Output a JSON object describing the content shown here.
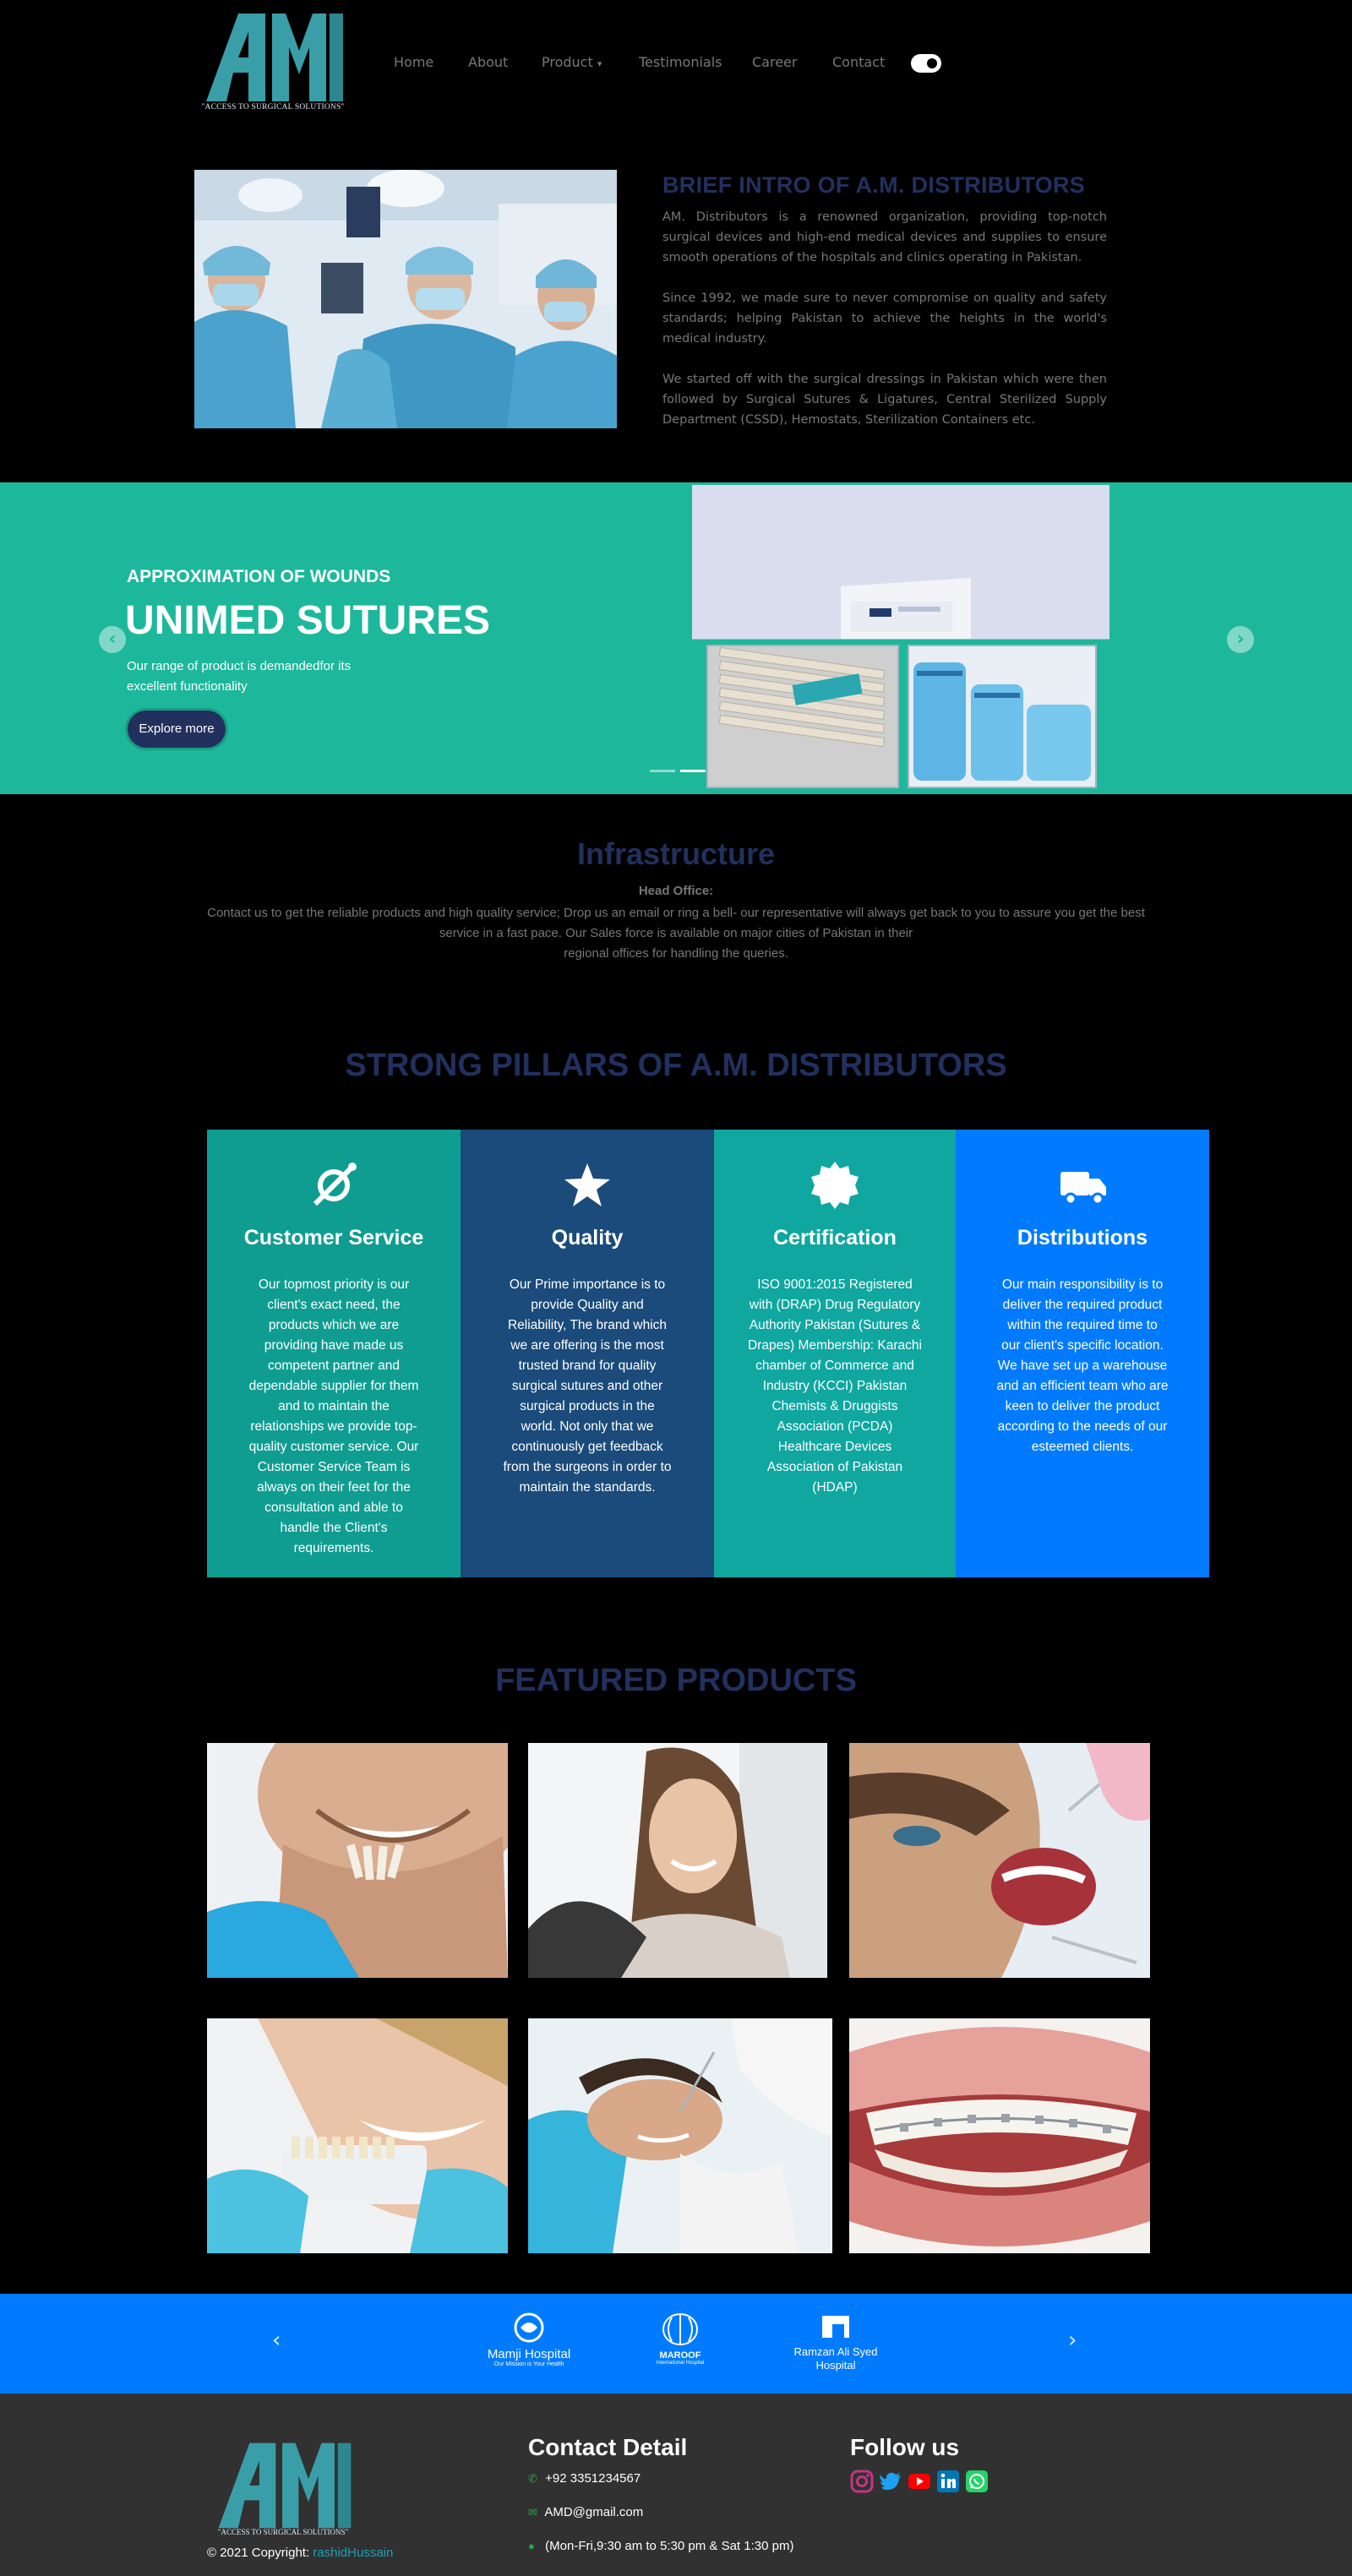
{
  "brand": {
    "tagline": "\"ACCESS TO SURGICAL SOLUTIONS\"",
    "logo_text": "AM"
  },
  "nav": {
    "items": [
      "Home",
      "About",
      "Product",
      "Testimonials",
      "Career",
      "Contact"
    ],
    "product_caret": "▾"
  },
  "intro": {
    "title": "BRIEF INTRO OF A.M. DISTRIBUTORS",
    "paragraphs": [
      "AM. Distributors is a renowned organization, providing top-notch surgical devices and high-end medical devices and supplies to ensure smooth operations of the hospitals and clinics operating in Pakistan.",
      "Since 1992, we made sure to never compromise on quality and safety standards; helping Pakistan to achieve the heights in the world's medical industry.",
      "We started off with the surgical dressings in Pakistan which were then followed by Surgical Sutures & Ligatures, Central Sterilized Supply Department (CSSD), Hemostats, Sterilization Containers etc."
    ]
  },
  "carousel": {
    "subtitle": "APPROXIMATION OF WOUNDS",
    "title": "UNIMED SUTURES",
    "description": "Our range of product is demandedfor its excellent functionality",
    "button": "Explore more",
    "prev_icon": "‹",
    "next_icon": "›",
    "active_slide": 2,
    "slide_count": 2
  },
  "infrastructure": {
    "title": "Infrastructure",
    "head_office": "Head Office:",
    "text_line1": "Contact us to get the reliable products and high quality service; Drop us an email or ring a bell- our representative will always get back to you to assure you get the best service in a fast pace. Our Sales force is available on major cities of Pakistan in their",
    "text_line2": "regional offices for handling the queries."
  },
  "pillars": {
    "title": "STRONG PILLARS OF A.M. DISTRIBUTORS",
    "items": [
      {
        "title": "Customer Service",
        "icon": "satellite-icon",
        "color": "#0f9d91",
        "text": "Our topmost priority is our client's exact need, the products which we are providing have made us competent partner and dependable supplier for them and to maintain the relationships we provide top-quality customer service. Our Customer Service Team is always on their feet for the consultation and able to handle the Client's requirements."
      },
      {
        "title": "Quality",
        "icon": "star-icon",
        "color": "#1a4b7a",
        "text": "Our Prime importance is to provide Quality and Reliability, The brand which we are offering is the most trusted brand for quality surgical sutures and other surgical products in the world. Not only that we continuously get feedback from the surgeons in order to maintain the standards."
      },
      {
        "title": "Certification",
        "icon": "certificate-icon",
        "color": "#0fa7a0",
        "text": "ISO 9001:2015 Registered with (DRAP) Drug Regulatory Authority Pakistan (Sutures & Drapes) Membership: Karachi chamber of Commerce and Industry (KCCI) Pakistan Chemists & Druggists Association (PCDA) Healthcare Devices Association of Pakistan (HDAP)"
      },
      {
        "title": "Distributions",
        "icon": "truck-icon",
        "color": "#007bff",
        "text": "Our main responsibility is to deliver the required product within the required time to our client's specific location. We have set up a warehouse and an efficient team who are keen to deliver the product according to the needs of our esteemed clients."
      }
    ]
  },
  "featured": {
    "title": "FEATURED PRODUCTS"
  },
  "partners": {
    "items": [
      {
        "name": "Mamji Hospital",
        "sub": "Our Mission is Your Health"
      },
      {
        "name": "MAROOF",
        "sub": "International Hospital"
      },
      {
        "name": "Ramzan Ali Syed",
        "sub": "Hospital"
      }
    ],
    "prev_icon": "‹",
    "next_icon": "›"
  },
  "footer": {
    "copyright_prefix": "© 2021 Copyright:",
    "copyright_link": "rashidHussain",
    "contact_title": "Contact Detail",
    "phone": "+92 3351234567",
    "email": "AMD@gmail.com",
    "hours": "(Mon-Fri,9:30 am to 5:30 pm & Sat 1:30 pm)",
    "follow_title": "Follow us",
    "social": [
      {
        "name": "instagram-icon",
        "color": "#c13584"
      },
      {
        "name": "twitter-icon",
        "color": "#1da1f2"
      },
      {
        "name": "youtube-icon",
        "color": "#ff0000"
      },
      {
        "name": "linkedin-icon",
        "color": "#0077b5"
      },
      {
        "name": "whatsapp-icon",
        "color": "#25d366"
      }
    ]
  }
}
